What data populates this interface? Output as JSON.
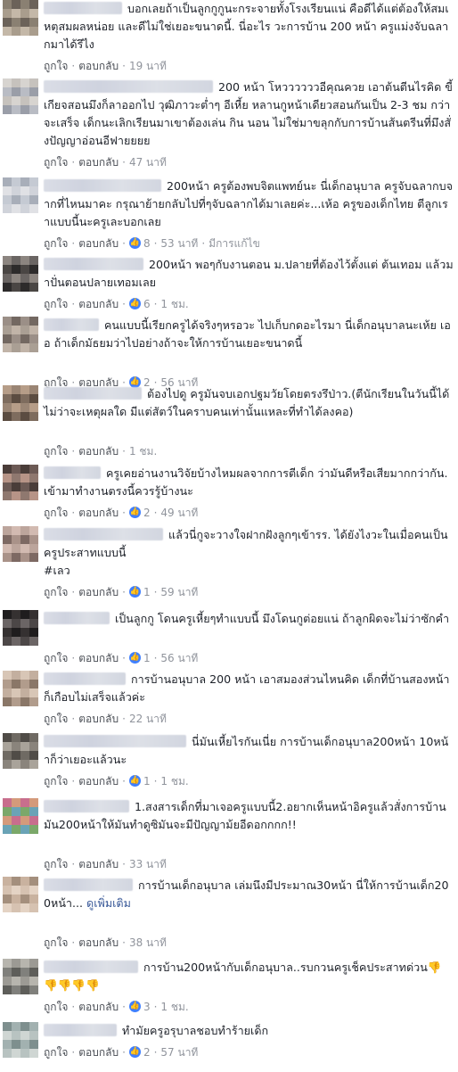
{
  "icons": {
    "like_badge": "thumbs-up-icon",
    "like_color": "#4080ff"
  },
  "comments": [
    {
      "name_width": 88,
      "text": "บอกเลยถ้าเป็นลูกกูกูนะกระจายทั้งโรงเรียนแน่ คือดีได้แต่ต้องให้สมเหตุสมผลหน่อย และดีไม่ใช่เยอะขนาดนี้. นี่อะไร วะการบ้าน 200 หน้า ครูแม่งจับฉลากมาได้รึไง",
      "like_label": "ถูกใจ",
      "reply_label": "ตอบกลับ",
      "time": "19 นาที",
      "reactions": null,
      "edited": null
    },
    {
      "name_width": 190,
      "text": "200 หน้า โหววววววอีคุณควย เอาต้นตีนไรคิด ขี้เกียจสอนมึงก็ลาออกไป วุฒิภาวะต่ำๆ อีเหี้ย หลานกูหน้าเดียวสอนกันเป็น 2-3 ชม กว่าจะเสร็จ เด็กนะเลิกเรียนมาเขาต้องเล่น กิน นอน ไม่ใช่มาขลุกกับการบ้านส้นตรีนที่มึงสั่งปัญญาอ่อนอีฟายยยย",
      "like_label": "ถูกใจ",
      "reply_label": "ตอบกลับ",
      "time": "47 นาที",
      "reactions": null,
      "edited": null
    },
    {
      "name_width": 132,
      "text": "200หน้า ครูต้องพบจิตแพทย์นะ นี่เด็กอนุบาล ครูจับฉลากบจากที่ไหนมาคะ กรุณาย้ายกลับไปที่ๆจับฉลากได้มาเลยค่ะ...เห้อ ครูของเด็กไทย ตีลูกเราแบบนี้นะครูเละบอกเลย",
      "like_label": "ถูกใจ",
      "reply_label": "ตอบกลับ",
      "time": "53 นาที",
      "reactions": "8",
      "edited": "มีการแก้ไข"
    },
    {
      "name_width": 112,
      "text": "200หน้า พอๆกับงานตอน ม.ปลายที่ต้องไว้ตั้งแต่ ต้นเทอม แล้วมาปั่นตอนปลายเทอมเลย",
      "like_label": "ถูกใจ",
      "reply_label": "ตอบกลับ",
      "time": "1 ชม.",
      "reactions": "6",
      "edited": null
    },
    {
      "name_width": 62,
      "text": "คนแบบนี้เรียกครูได้จริงๆหรอวะ ไปเก็บกดอะไรมา นี่เด็กอนุบาลนะเห้ย เออ ถ้าเด็กมัธยมว่าไปอย่างถ้าจะให้การบ้านเยอะขนาดนี้",
      "like_label": "ถูกใจ",
      "reply_label": "ตอบกลับ",
      "time": "56 นาที",
      "reactions": "2",
      "edited": null
    },
    {
      "name_width": 110,
      "text": "ต้องไปดู ครูมันจบเอกปฐมวัยโดยตรงรึป่าว.(ตีนักเรียนในวันนี้ได้ ไม่ว่าจะเหตุผลใด มีแต่สัตว์ในคราบคนเท่านั้นแหละที่ทำได้ลงคอ)",
      "like_label": "ถูกใจ",
      "reply_label": "ตอบกลับ",
      "time": "1 ชม.",
      "reactions": null,
      "edited": null
    },
    {
      "name_width": 64,
      "text": "ครูเคยอ่านงานวิจัยบ้างไหมผลจากการตีเด็ก ว่ามันดีหรือเสียมากกว่ากัน. เข้ามาทำงานตรงนี้ควรรู้บ้างนะ",
      "like_label": "ถูกใจ",
      "reply_label": "ตอบกลับ",
      "time": "49 นาที",
      "reactions": "2",
      "edited": null
    },
    {
      "name_width": 134,
      "text": "แล้วนี่กูจะวางใจฝากฝังลูกๆเข้ารร. ได้ยังไงวะในเมื่อคนเป็นครูประสาทแบบนี้",
      "tag": "#เลว",
      "like_label": "ถูกใจ",
      "reply_label": "ตอบกลับ",
      "time": "59 นาที",
      "reactions": "1",
      "edited": null
    },
    {
      "name_width": 74,
      "text": "เป็นลูกกู โดนครูเหี้ยๆทำแบบนี้ มึงโดนกูต่อยแน่ ถ้าลูกผิดจะไม่ว่าซักคำ",
      "like_label": "ถูกใจ",
      "reply_label": "ตอบกลับ",
      "time": "56 นาที",
      "reactions": "1",
      "edited": null
    },
    {
      "name_width": 92,
      "text": "การบ้านอนุบาล 200 หน้า เอาสมองส่วนไหนคิด เด็กที่บ้านสองหน้าก็เกือบไม่เสร็จแล้วค่ะ",
      "like_label": "ถูกใจ",
      "reply_label": "ตอบกลับ",
      "time": "22 นาที",
      "reactions": null,
      "edited": null
    },
    {
      "name_width": 160,
      "text": "นี่มันเหี้ยไรกันเนี่ย การบ้านเด็กอนุบาล200หน้า 10หน้าก็ว่าเยอะแล้วนะ",
      "like_label": "ถูกใจ",
      "reply_label": "ตอบกลับ",
      "time": "1 ชม.",
      "reactions": "1",
      "edited": null
    },
    {
      "name_width": 96,
      "text": "1.สงสารเด็กที่มาเจอครูแบบนี้2.อยากเห็นหน้าอิครูแล้วสั่งการบ้านมัน200หน้าให้มันทำดูซิมันจะมีปัญญาม้ยอีดอกกกก!!",
      "like_label": "ถูกใจ",
      "reply_label": "ตอบกลับ",
      "time": "33 นาที",
      "reactions": null,
      "edited": null
    },
    {
      "name_width": 100,
      "text": "การบ้านเด็กอนุบาล เล่มนึงมีประมาณ30หน้า นี่ให้การบ้านเด็ก200หน้า...",
      "see_more": "ดูเพิ่มเติม",
      "like_label": "ถูกใจ",
      "reply_label": "ตอบกลับ",
      "time": "38 นาที",
      "reactions": null,
      "edited": null
    },
    {
      "name_width": 106,
      "text": "การบ้าน200หน้ากับเด็กอนุบาล..รบกวนครูเช็คประสาทด่วน👎👎👎👎👎",
      "like_label": "ถูกใจ",
      "reply_label": "ตอบกลับ",
      "time": "1 ชม.",
      "reactions": "3",
      "edited": null
    },
    {
      "name_width": 82,
      "text": "ทำมัยครูอรุบาลชอบทำร้ายเด็ก",
      "like_label": "ถูกใจ",
      "reply_label": "ตอบกลับ",
      "time": "57 นาที",
      "reactions": "2",
      "edited": null
    }
  ]
}
